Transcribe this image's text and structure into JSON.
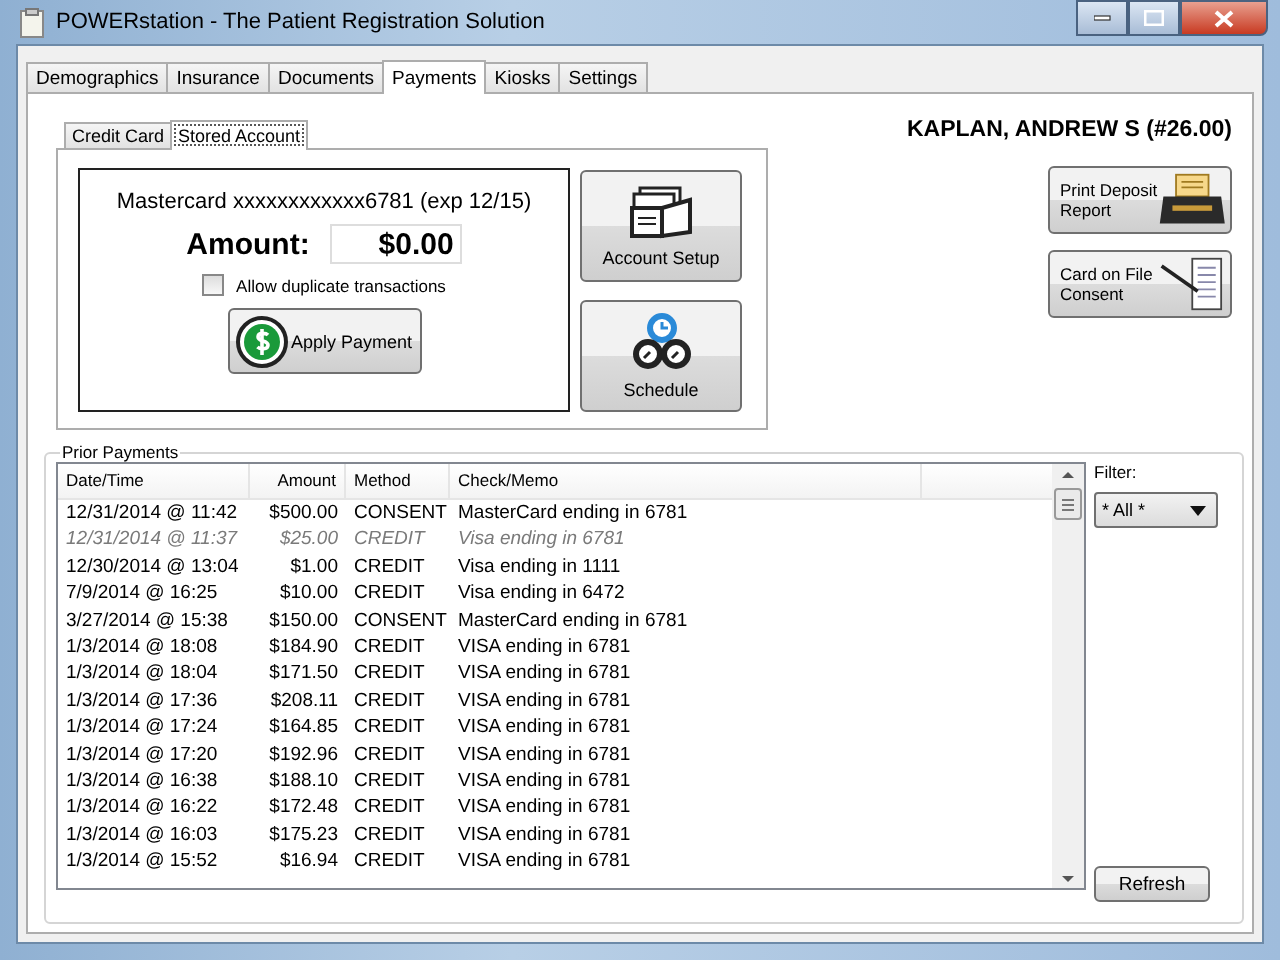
{
  "window": {
    "title": "POWERstation - The Patient Registration Solution"
  },
  "tabs": [
    {
      "label": "Demographics",
      "selected": false
    },
    {
      "label": "Insurance",
      "selected": false
    },
    {
      "label": "Documents",
      "selected": false
    },
    {
      "label": "Payments",
      "selected": true
    },
    {
      "label": "Kiosks",
      "selected": false
    },
    {
      "label": "Settings",
      "selected": false
    }
  ],
  "sub_tabs": [
    {
      "label": "Credit Card",
      "selected": false
    },
    {
      "label": "Stored Account",
      "selected": true
    }
  ],
  "patient": "KAPLAN, ANDREW S (#26.00)",
  "stored_account": {
    "card": "Mastercard xxxxxxxxxxxx6781 (exp 12/15)",
    "amount_label": "Amount:",
    "amount": "$0.00",
    "allow_duplicates": {
      "label": "Allow duplicate transactions",
      "checked": false
    },
    "apply_button": "Apply Payment",
    "account_setup_button": "Account Setup",
    "schedule_button": "Schedule"
  },
  "side_buttons": [
    "Print Deposit Report",
    "Card on File Consent"
  ],
  "prior_payments": {
    "title": "Prior Payments",
    "columns": [
      "Date/Time",
      "Amount",
      "Method",
      "Check/Memo"
    ],
    "rows": [
      {
        "date": "12/31/2014 @ 11:42",
        "amount": "$500.00",
        "method": "CONSENT",
        "memo": "MasterCard ending in 6781",
        "voided": false
      },
      {
        "date": "12/31/2014 @ 11:37",
        "amount": "$25.00",
        "method": "CREDIT",
        "memo": "Visa ending in 6781",
        "voided": true
      },
      {
        "date": "12/30/2014 @ 13:04",
        "amount": "$1.00",
        "method": "CREDIT",
        "memo": "Visa ending in 1111",
        "voided": false
      },
      {
        "date": "7/9/2014 @ 16:25",
        "amount": "$10.00",
        "method": "CREDIT",
        "memo": "Visa ending in 6472",
        "voided": false
      },
      {
        "date": "3/27/2014 @ 15:38",
        "amount": "$150.00",
        "method": "CONSENT",
        "memo": "MasterCard ending in 6781",
        "voided": false
      },
      {
        "date": "1/3/2014 @ 18:08",
        "amount": "$184.90",
        "method": "CREDIT",
        "memo": "VISA ending in 6781",
        "voided": false
      },
      {
        "date": "1/3/2014 @ 18:04",
        "amount": "$171.50",
        "method": "CREDIT",
        "memo": "VISA ending in 6781",
        "voided": false
      },
      {
        "date": "1/3/2014 @ 17:36",
        "amount": "$208.11",
        "method": "CREDIT",
        "memo": "VISA ending in 6781",
        "voided": false
      },
      {
        "date": "1/3/2014 @ 17:24",
        "amount": "$164.85",
        "method": "CREDIT",
        "memo": "VISA ending in 6781",
        "voided": false
      },
      {
        "date": "1/3/2014 @ 17:20",
        "amount": "$192.96",
        "method": "CREDIT",
        "memo": "VISA ending in 6781",
        "voided": false
      },
      {
        "date": "1/3/2014 @ 16:38",
        "amount": "$188.10",
        "method": "CREDIT",
        "memo": "VISA ending in 6781",
        "voided": false
      },
      {
        "date": "1/3/2014 @ 16:22",
        "amount": "$172.48",
        "method": "CREDIT",
        "memo": "VISA ending in 6781",
        "voided": false
      },
      {
        "date": "1/3/2014 @ 16:03",
        "amount": "$175.23",
        "method": "CREDIT",
        "memo": "VISA ending in 6781",
        "voided": false
      },
      {
        "date": "1/3/2014 @ 15:52",
        "amount": "$16.94",
        "method": "CREDIT",
        "memo": "VISA ending in 6781",
        "voided": false
      }
    ],
    "filter_label": "Filter:",
    "filter_value": "* All *",
    "refresh_button": "Refresh"
  }
}
